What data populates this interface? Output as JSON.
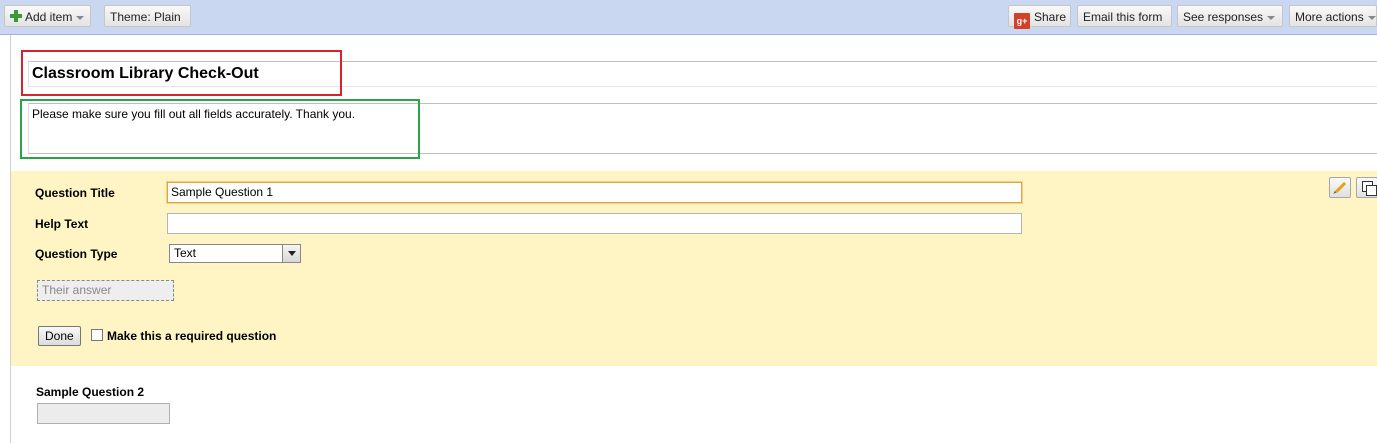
{
  "toolbar": {
    "add_item": "Add item",
    "theme": "Theme:  Plain",
    "share": "Share",
    "share_icon": "g+",
    "email": "Email this form",
    "responses": "See responses",
    "more": "More actions"
  },
  "form": {
    "title": "Classroom Library Check-Out",
    "description": "Please make sure you fill out all fields accurately.  Thank you."
  },
  "edit_question": {
    "title_label": "Question Title",
    "title_value": "Sample Question 1",
    "help_label": "Help Text",
    "help_value": "",
    "type_label": "Question Type",
    "type_value": "Text",
    "answer_placeholder": "Their answer",
    "done": "Done",
    "required_label": "Make this a required question",
    "required_checked": false
  },
  "question2": {
    "title": "Sample Question 2"
  },
  "colors": {
    "toolbar_bg": "#c9d7f1",
    "edit_panel_bg": "#fff4c4",
    "highlight_red": "#d6232f",
    "highlight_green": "#2aa34a"
  }
}
